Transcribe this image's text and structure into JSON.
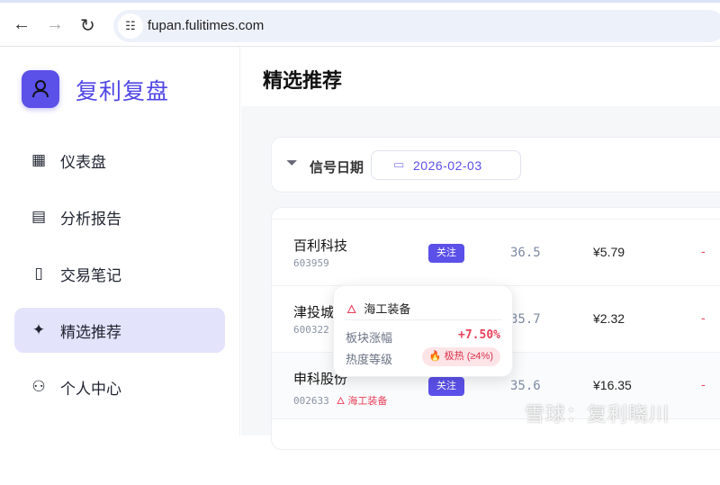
{
  "browser": {
    "url": "fupan.fulitimes.com"
  },
  "sidebar": {
    "brand": "复利复盘",
    "items": [
      {
        "label": "仪表盘",
        "icon": "dashboard-icon"
      },
      {
        "label": "分析报告",
        "icon": "document-icon"
      },
      {
        "label": "交易笔记",
        "icon": "book-icon"
      },
      {
        "label": "精选推荐",
        "icon": "sparkles-icon",
        "active": true
      },
      {
        "label": "个人中心",
        "icon": "user-icon"
      }
    ]
  },
  "page": {
    "title": "精选推荐"
  },
  "filter": {
    "label": "信号日期",
    "date": "2026-02-03"
  },
  "rows": [
    {
      "name": "百利科技",
      "code": "603959",
      "badge": "关注",
      "score": "36.5",
      "price": "¥5.79",
      "change": "-"
    },
    {
      "name": "津投城",
      "code": "600322",
      "badge": "",
      "score": "35.7",
      "price": "¥2.32",
      "change": "-"
    },
    {
      "name": "申科股份",
      "code": "002633",
      "tag": "海工装备",
      "badge": "关注",
      "score": "35.6",
      "price": "¥16.35",
      "change": "-"
    }
  ],
  "tooltip": {
    "title": "海工装备",
    "rise_label": "板块涨幅",
    "rise_value": "+7.50%",
    "heat_label": "热度等级",
    "heat_value": "🔥 极热 (≥4%)"
  },
  "watermark": "雪球：复利晓川"
}
